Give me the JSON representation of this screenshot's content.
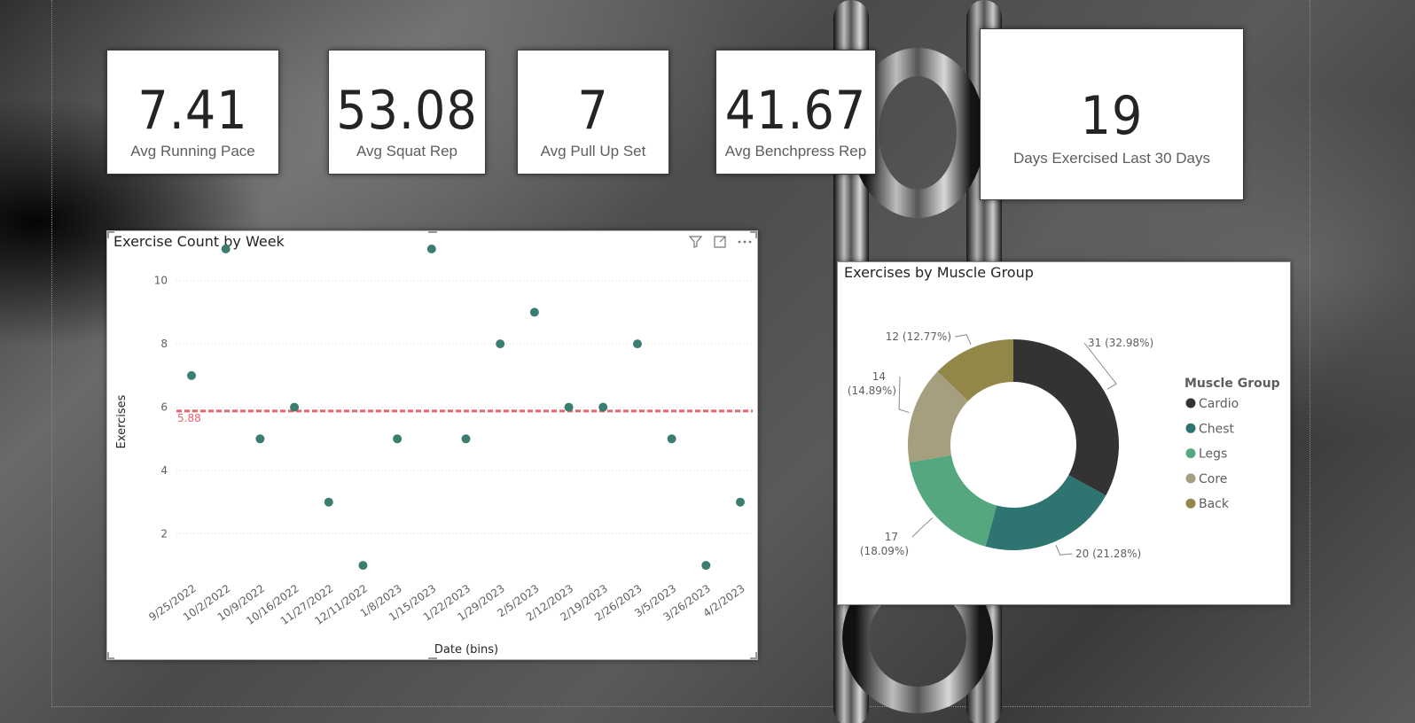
{
  "kpis": [
    {
      "value": "7.41",
      "label": "Avg Running Pace"
    },
    {
      "value": "53.08",
      "label": "Avg Squat Rep"
    },
    {
      "value": "7",
      "label": "Avg Pull Up Set"
    },
    {
      "value": "41.67",
      "label": "Avg Benchpress Rep"
    },
    {
      "value": "19",
      "label": "Days Exercised Last 30 Days"
    }
  ],
  "scatter": {
    "title": "Exercise Count by Week",
    "icons": [
      "filter-icon",
      "focus-mode-icon",
      "more-options-icon"
    ]
  },
  "donut": {
    "title": "Exercises by Muscle Group",
    "legend_title": "Muscle Group"
  },
  "chart_data": [
    {
      "type": "scatter",
      "title": "Exercise Count by Week",
      "xlabel": "Date (bins)",
      "ylabel": "Exercises",
      "ylim": [
        0.5,
        11
      ],
      "yticks": [
        2,
        4,
        6,
        8,
        10
      ],
      "grid": true,
      "x": [
        "9/25/2022",
        "10/2/2022",
        "10/9/2022",
        "10/16/2022",
        "11/27/2022",
        "12/11/2022",
        "1/8/2023",
        "1/15/2023",
        "1/22/2023",
        "1/29/2023",
        "2/5/2023",
        "2/12/2023",
        "2/19/2023",
        "2/26/2023",
        "3/5/2023",
        "3/26/2023",
        "4/2/2023"
      ],
      "y": [
        7,
        11,
        5,
        6,
        3,
        1,
        5,
        11,
        5,
        8,
        9,
        6,
        6,
        8,
        5,
        1,
        3
      ],
      "average_line": {
        "value": 5.88,
        "label": "5.88",
        "color": "#e8666b"
      },
      "point_color": "#3b7d70"
    },
    {
      "type": "pie",
      "title": "Exercises by Muscle Group",
      "legend_title": "Muscle Group",
      "legend_position": "right",
      "hole": true,
      "series": [
        {
          "name": "Cardio",
          "value": 31,
          "label": "31 (32.98%)",
          "color": "#333333"
        },
        {
          "name": "Chest",
          "value": 20,
          "label": "20 (21.28%)",
          "color": "#2e7571"
        },
        {
          "name": "Legs",
          "value": 17,
          "label": "17 (18.09%)",
          "color": "#55a77f"
        },
        {
          "name": "Core",
          "value": 14,
          "label": "14 (14.89%)",
          "color": "#a59e7f"
        },
        {
          "name": "Back",
          "value": 12,
          "label": "12 (12.77%)",
          "color": "#928748"
        }
      ]
    }
  ]
}
